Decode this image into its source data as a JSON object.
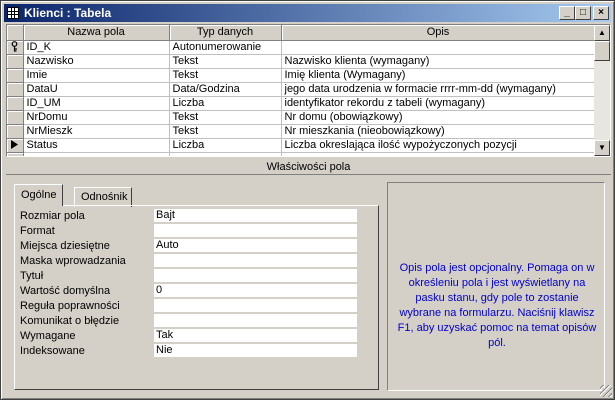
{
  "window": {
    "title": "Klienci : Tabela"
  },
  "title_buttons": {
    "minimize": "_",
    "maximize": "□",
    "close": "×"
  },
  "grid": {
    "headers": [
      "Nazwa pola",
      "Typ danych",
      "Opis"
    ],
    "rows": [
      {
        "marker": "key",
        "name": "ID_K",
        "type": "Autonumerowanie",
        "desc": ""
      },
      {
        "marker": "",
        "name": "Nazwisko",
        "type": "Tekst",
        "desc": "Nazwisko klienta (wymagany)"
      },
      {
        "marker": "",
        "name": "Imie",
        "type": "Tekst",
        "desc": "Imię klienta (Wymagany)"
      },
      {
        "marker": "",
        "name": "DataU",
        "type": "Data/Godzina",
        "desc": "jego data urodzenia w formacie rrrr-mm-dd (wymagany)"
      },
      {
        "marker": "",
        "name": "ID_UM",
        "type": "Liczba",
        "desc": "identyfikator rekordu z tabeli (wymagany)"
      },
      {
        "marker": "",
        "name": "NrDomu",
        "type": "Tekst",
        "desc": "Nr domu (obowiązkowy)"
      },
      {
        "marker": "",
        "name": "NrMieszk",
        "type": "Tekst",
        "desc": "Nr mieszkania (nieobowiązkowy)"
      },
      {
        "marker": "current",
        "name": "Status",
        "type": "Liczba",
        "desc": "Liczba okreslająca ilość wypożyczonych pozycji"
      },
      {
        "marker": "",
        "name": "",
        "type": "",
        "desc": ""
      }
    ]
  },
  "properties": {
    "section_title": "Właściwości pola",
    "tabs": [
      "Ogólne",
      "Odnośnik"
    ],
    "rows": [
      {
        "label": "Rozmiar pola",
        "value": "Bajt"
      },
      {
        "label": "Format",
        "value": ""
      },
      {
        "label": "Miejsca dziesiętne",
        "value": "Auto"
      },
      {
        "label": "Maska wprowadzania",
        "value": ""
      },
      {
        "label": "Tytuł",
        "value": ""
      },
      {
        "label": "Wartość domyślna",
        "value": "0"
      },
      {
        "label": "Reguła poprawności",
        "value": ""
      },
      {
        "label": "Komunikat o błędzie",
        "value": ""
      },
      {
        "label": "Wymagane",
        "value": "Tak"
      },
      {
        "label": "Indeksowane",
        "value": "Nie"
      }
    ]
  },
  "help": {
    "text": "Opis pola jest opcjonalny. Pomaga on w określeniu pola i jest wyświetlany na pasku stanu, gdy pole to zostanie wybrane na formularzu. Naciśnij klawisz F1, aby uzyskać pomoc na temat opisów pól."
  }
}
